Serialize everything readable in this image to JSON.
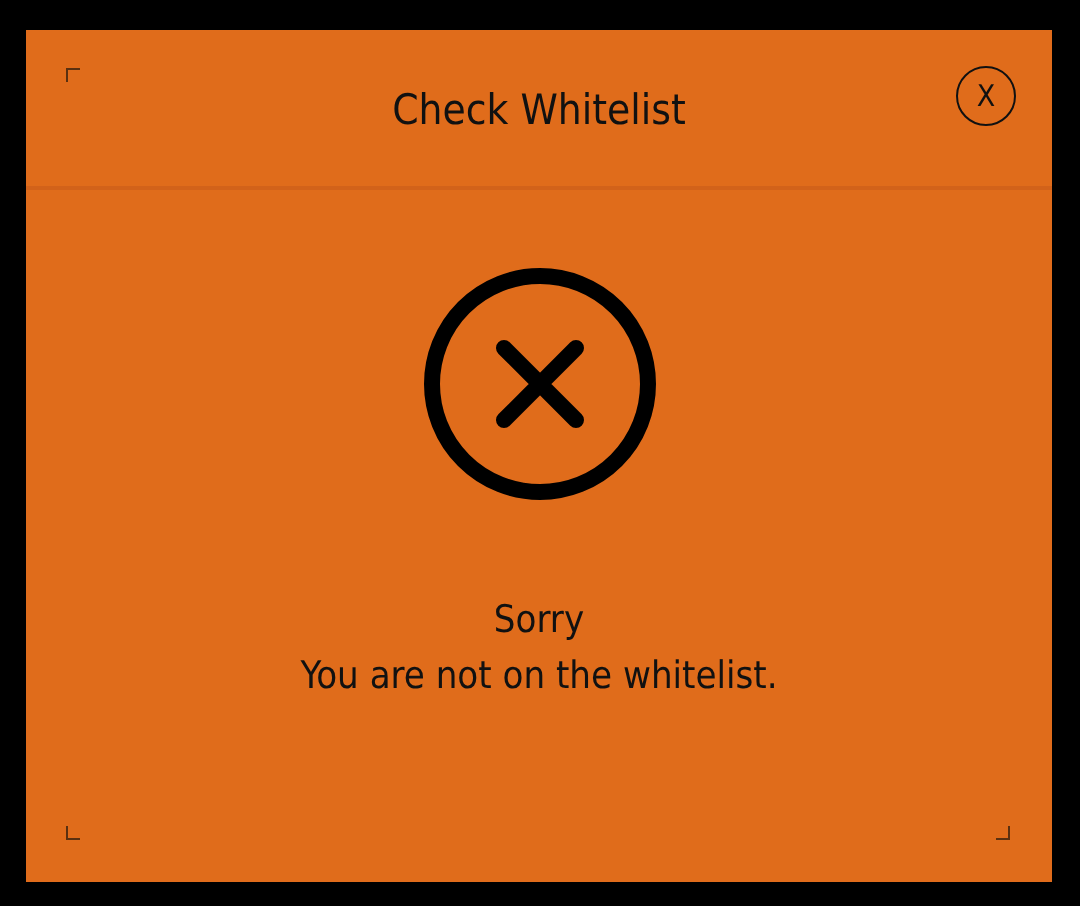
{
  "dialog": {
    "title": "Check Whitelist",
    "close_button": "X",
    "kind": "error",
    "heading": "Sorry",
    "message": "You are not on the whitelist."
  }
}
